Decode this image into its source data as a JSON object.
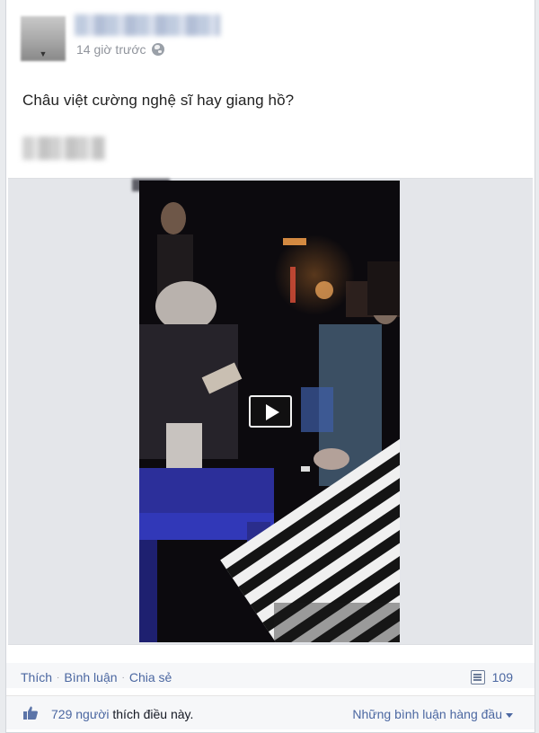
{
  "header": {
    "timestamp": "14 giờ trước",
    "privacy_icon": "globe-icon",
    "avatar_icon": "chevron-down-icon"
  },
  "post": {
    "text": "Châu việt cường nghệ sĩ hay giang hồ?"
  },
  "video": {
    "play_icon": "play-icon"
  },
  "actions": {
    "like": "Thích",
    "comment": "Bình luận",
    "share": "Chia sẻ",
    "separator": "·",
    "comment_count": "109",
    "comment_icon": "comment-icon"
  },
  "likes": {
    "count": "729 người",
    "suffix": " thích điều này.",
    "sort_label": "Những bình luận hàng đầu",
    "like_icon": "thumbs-up-icon"
  },
  "colors": {
    "link": "#4b67a1",
    "meta": "#90949c",
    "bar_bg": "#f6f7f9"
  }
}
